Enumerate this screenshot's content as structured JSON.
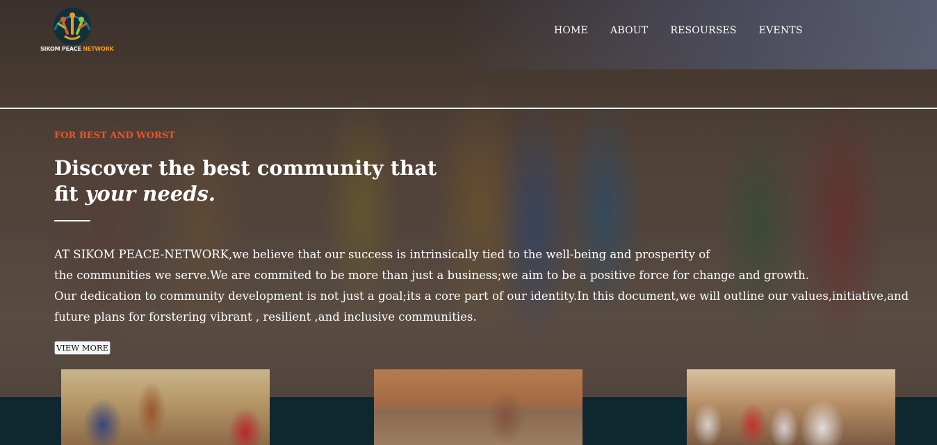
{
  "brand": {
    "name_part1": "SIKOM PEACE",
    "name_part2": "NETWORK"
  },
  "nav": {
    "items": [
      "HOME",
      "ABOUT",
      "RESOURSES",
      "EVENTS"
    ]
  },
  "hero": {
    "kicker": "FOR BEST AND WORST",
    "headline_line1": "Discover the best community that",
    "headline_line2_prefix": "fit ",
    "headline_line2_emphasis": "your needs.",
    "body_lines": [
      "AT SIKOM PEACE-NETWORK,we believe that our success is intrinsically tied to the well-being and prosperity of",
      "the communities we serve.We are commited to be more than just a business;we aim to be a positive force for change and growth.",
      "Our dedication to community development is not just a goal;its a core part of our identity.In this document,we will outline our values,initiative,and",
      "future plans for forstering vibrant , resilient ,and inclusive communities."
    ],
    "button_label": "VIEW MORE"
  },
  "colors": {
    "accent": "#e4562d",
    "logo_accent": "#f39a1d",
    "band": "#0f2830"
  }
}
